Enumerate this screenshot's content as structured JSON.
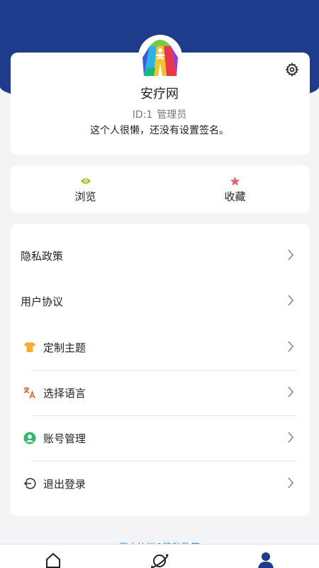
{
  "profile": {
    "name": "安疗网",
    "id_label": "ID:1",
    "role": "管理员",
    "bio": "这个人很懒，还没有设置签名。"
  },
  "stats": [
    {
      "label": "浏览",
      "icon": "eye-icon",
      "color": "#9cc31a"
    },
    {
      "label": "收藏",
      "icon": "star-icon",
      "color": "#e06a73"
    }
  ],
  "menu": [
    {
      "label": "隐私政策"
    },
    {
      "label": "用户协议"
    },
    {
      "label": "定制主题",
      "icon": "shirt-icon",
      "color": "#f2b02e"
    },
    {
      "label": "选择语言",
      "icon": "translate-icon",
      "color": "#e8603c"
    },
    {
      "label": "账号管理",
      "icon": "user-circle-icon",
      "color": "#35b86b"
    },
    {
      "label": "退出登录",
      "icon": "logout-icon",
      "color": "#333333"
    }
  ],
  "footer": {
    "agreement_text": "用户协议&隐私政策"
  },
  "tabs": [
    {
      "icon": "home-icon"
    },
    {
      "icon": "planet-icon"
    },
    {
      "icon": "person-icon",
      "active": true
    }
  ],
  "colors": {
    "header": "#1f3b8c",
    "accent": "#1f3b8c",
    "link": "#3a8be0"
  }
}
